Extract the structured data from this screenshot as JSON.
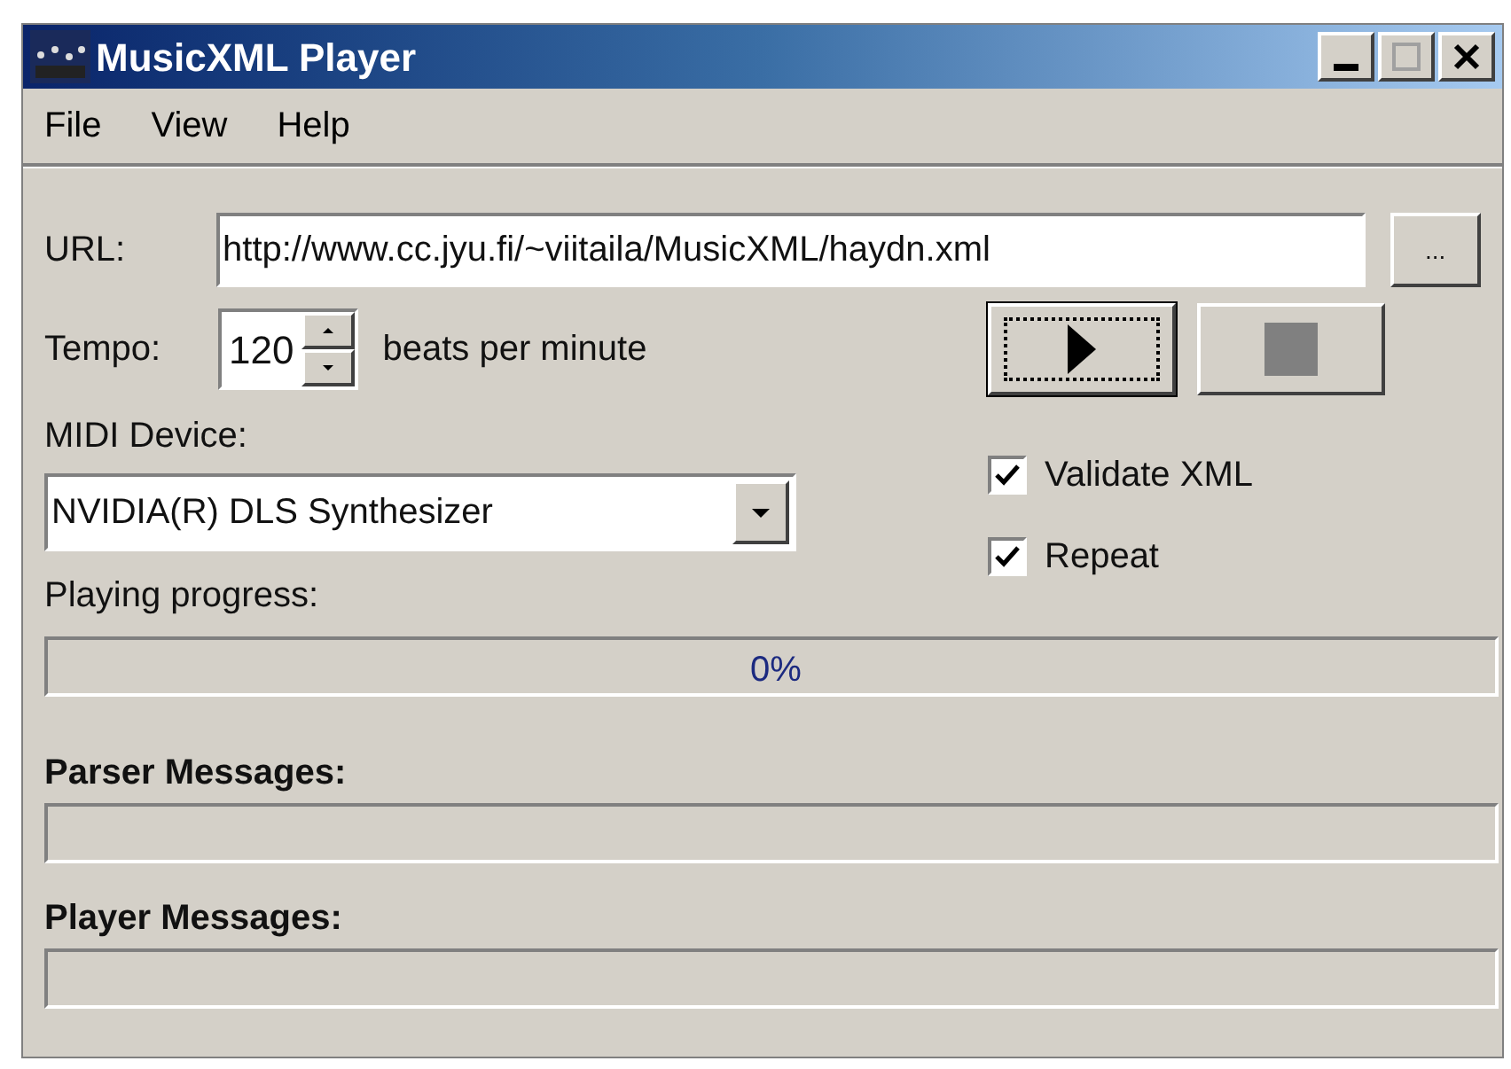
{
  "window": {
    "title": "MusicXML Player"
  },
  "menu": [
    "File",
    "View",
    "Help"
  ],
  "url": {
    "label": "URL:",
    "value": "http://www.cc.jyu.fi/~viitaila/MusicXML/haydn.xml",
    "browse": "..."
  },
  "tempo": {
    "label": "Tempo:",
    "value": "120",
    "unit": "beats per minute"
  },
  "transport": [
    {
      "kind": "play",
      "focused": true,
      "disabled": false
    },
    {
      "kind": "stop",
      "focused": false,
      "disabled": true
    }
  ],
  "midi": {
    "label": "MIDI Device:",
    "value": "NVIDIA(R) DLS Synthesizer"
  },
  "options": [
    {
      "label": "Validate XML",
      "checked": true
    },
    {
      "label": "Repeat",
      "checked": true
    }
  ],
  "progress": {
    "label": "Playing progress:",
    "level": 0,
    "reading": "0%"
  },
  "parser": {
    "label": "Parser Messages:"
  },
  "player": {
    "label": "Player Messages:"
  }
}
